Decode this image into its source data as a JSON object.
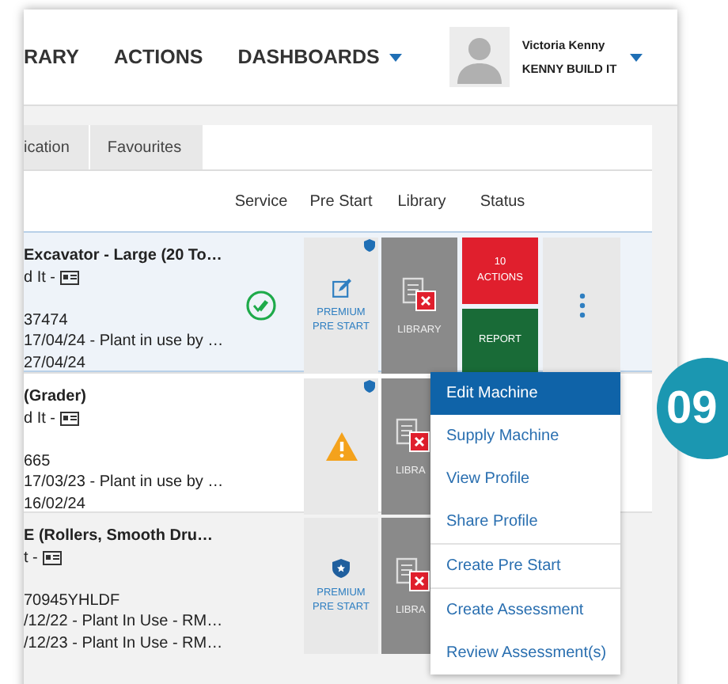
{
  "nav": {
    "items": [
      {
        "label": "RARY",
        "dropdown": false
      },
      {
        "label": "ACTIONS",
        "dropdown": false
      },
      {
        "label": "DASHBOARDS",
        "dropdown": true
      }
    ]
  },
  "user": {
    "name": "Victoria Kenny",
    "company": "KENNY BUILD IT"
  },
  "tabs": [
    {
      "label": "ication",
      "selected": false
    },
    {
      "label": "Favourites",
      "selected": false
    }
  ],
  "table": {
    "columns": [
      "Service",
      "Pre Start",
      "Library",
      "Status"
    ],
    "rows": [
      {
        "selected": true,
        "title": "Excavator - Large (20 To…",
        "owner": "d It -",
        "id": "37474",
        "line_1": "17/04/24 - Plant in use by …",
        "line_2": "27/04/24",
        "serviced": true,
        "pre_start": {
          "kind": "premium",
          "label": "PREMIUM PRE START",
          "badge": true
        },
        "library": "LIBRARY",
        "status": [
          {
            "count": "10",
            "label": "ACTIONS",
            "color": "#e01f2d"
          },
          {
            "label": "REPORT",
            "color": "#196b37"
          }
        ],
        "more": true
      },
      {
        "selected": false,
        "title": "(Grader)",
        "owner": "d It -",
        "id": "665",
        "line_1": "17/03/23 - Plant in use by …",
        "line_2": "16/02/24",
        "serviced": false,
        "pre_start": {
          "kind": "warning",
          "badge": true
        },
        "library": "LIBRA"
      },
      {
        "selected": false,
        "title": "E (Rollers, Smooth Dru…",
        "owner": "t -",
        "id": "70945YHLDF",
        "line_1": "/12/22 - Plant In Use - RM…",
        "line_2": "/12/23 - Plant In Use - RM…",
        "serviced": false,
        "pre_start": {
          "kind": "shield",
          "label": "PREMIUM PRE START",
          "badge": false
        },
        "library": "LIBRA"
      }
    ]
  },
  "menu": {
    "items": [
      {
        "label": "Edit Machine",
        "selected": true,
        "divider_before": false
      },
      {
        "label": "Supply Machine",
        "selected": false,
        "divider_before": false
      },
      {
        "label": "View Profile",
        "selected": false,
        "divider_before": false
      },
      {
        "label": "Share Profile",
        "selected": false,
        "divider_before": false
      },
      {
        "label": "Create Pre Start",
        "selected": false,
        "divider_before": true
      },
      {
        "label": "Create Assessment",
        "selected": false,
        "divider_before": true
      },
      {
        "label": "Review Assessment(s)",
        "selected": false,
        "divider_before": false
      }
    ]
  },
  "step_badge": {
    "label": "09"
  }
}
